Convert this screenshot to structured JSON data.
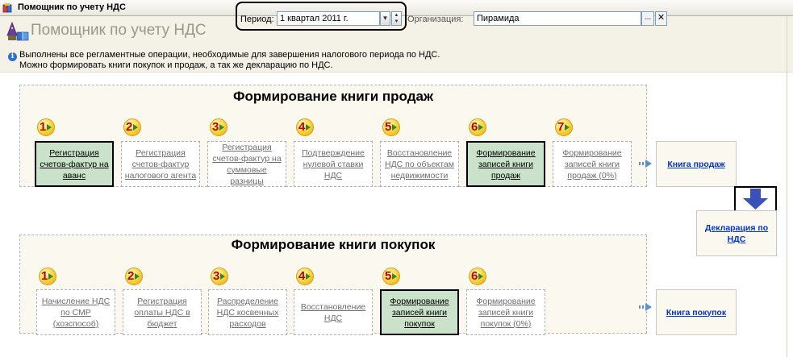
{
  "window": {
    "title": "Помощник по учету НДС"
  },
  "header": {
    "app_title": "Помощник по учету НДС",
    "period_label": "Период:",
    "period_value": "1 квартал 2011 г.",
    "org_label": "Организация:",
    "org_value": "Пирамида",
    "org_select_label": "...",
    "org_clear_label": "✕"
  },
  "info": {
    "line1": "Выполнены все регламентные операции, необходимые для завершения налогового периода по НДС.",
    "line2": "Можно формировать книги покупок и продаж, а так же декларацию по НДС."
  },
  "sales": {
    "title": "Формирование книги продаж",
    "steps": [
      {
        "num": "1",
        "label": "Регистрация счетов-фактур на аванс",
        "active": true
      },
      {
        "num": "2",
        "label": "Регистрация счетов-фактур налогового агента",
        "active": false
      },
      {
        "num": "3",
        "label": "Регистрация счетов-фактур на суммовые разницы",
        "active": false
      },
      {
        "num": "4",
        "label": "Подтверждение нулевой ставки НДС",
        "active": false
      },
      {
        "num": "5",
        "label": "Восстановление НДС по объектам недвижимости",
        "active": false
      },
      {
        "num": "6",
        "label": "Формирование записей книги продаж",
        "active": true
      },
      {
        "num": "7",
        "label": "Формирование записей книги продаж (0%)",
        "active": false
      }
    ],
    "book_label": "Книга продаж"
  },
  "purchases": {
    "title": "Формирование книги покупок",
    "steps": [
      {
        "num": "1",
        "label": "Начисление НДС по СМР (хозспособ)",
        "active": false
      },
      {
        "num": "2",
        "label": "Регистрация оплаты НДС в бюджет",
        "active": false
      },
      {
        "num": "3",
        "label": "Распределение НДС косвенных расходов",
        "active": false
      },
      {
        "num": "4",
        "label": "Восстановление НДС",
        "active": false
      },
      {
        "num": "5",
        "label": "Формирование записей книги покупок",
        "active": true
      },
      {
        "num": "6",
        "label": "Формирование записей книги покупок (0%)",
        "active": false
      }
    ],
    "book_label": "Книга покупок"
  },
  "declaration": {
    "label": "Декларация по НДС"
  },
  "colors": {
    "active_step_bg": "#c9e2c9",
    "link": "#0033cc",
    "header_bg": "#f4f1e6",
    "down_arrow": "#3a52b8"
  },
  "icons": {
    "window": "book-icon",
    "app": "wizard-book-icon",
    "info": "info-icon",
    "step_marker": "numbered-ball-arrow-icon",
    "down_arrow": "down-arrow-icon"
  }
}
